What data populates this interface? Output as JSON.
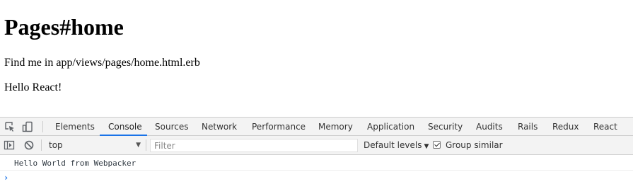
{
  "page": {
    "title": "Pages#home",
    "paragraphs": [
      "Find me in app/views/pages/home.html.erb",
      "Hello React!"
    ]
  },
  "devtools": {
    "icons": [
      "inspect-element-icon",
      "device-toolbar-icon",
      "sidebar-toggle-icon",
      "clear-console-icon",
      "prompt-chevron-icon"
    ],
    "tabs": [
      "Elements",
      "Console",
      "Sources",
      "Network",
      "Performance",
      "Memory",
      "Application",
      "Security",
      "Audits",
      "Rails",
      "Redux",
      "React"
    ],
    "active_tab": "Console",
    "accent_color": "#1a73e8",
    "toolbar": {
      "context": "top",
      "filter_placeholder": "Filter",
      "levels_label": "Default levels",
      "group_similar_label": "Group similar",
      "group_similar_checked": true
    },
    "console": {
      "messages": [
        "Hello World from Webpacker"
      ],
      "prompt": "›"
    }
  }
}
